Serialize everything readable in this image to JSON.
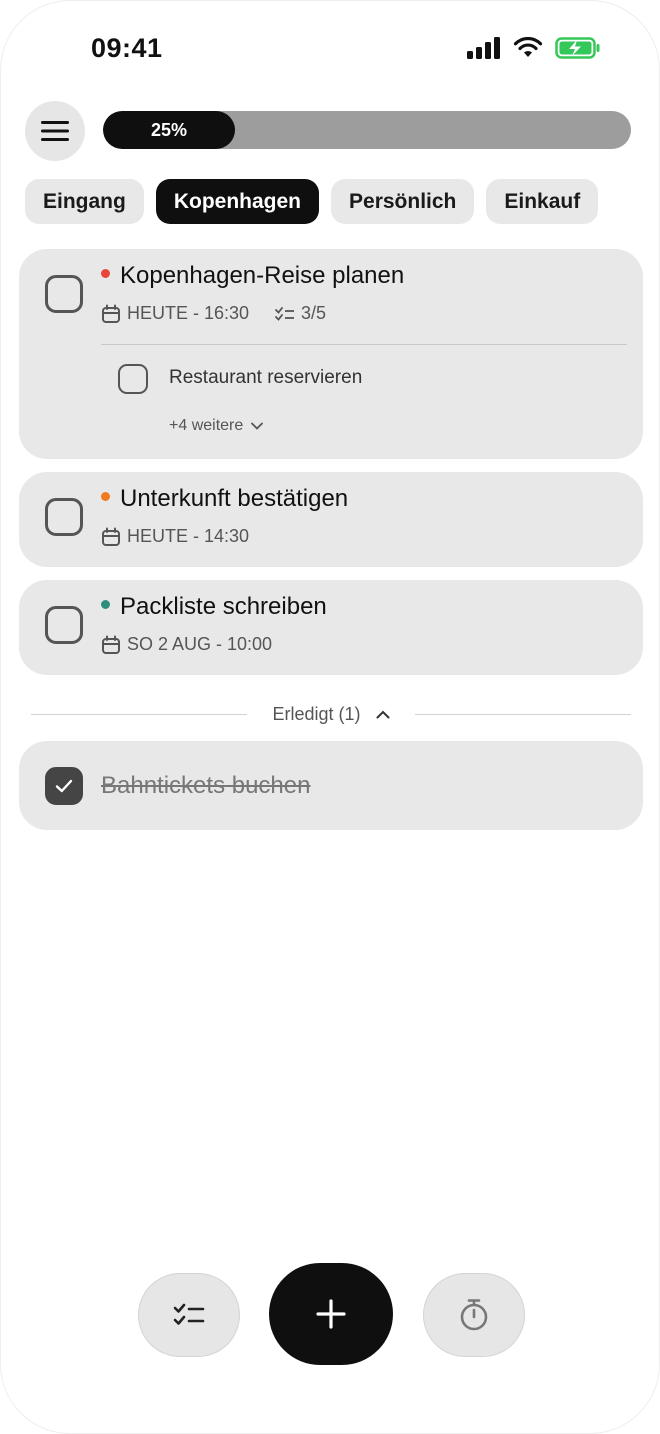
{
  "status": {
    "time": "09:41"
  },
  "progress": {
    "percent": 25,
    "label": "25%"
  },
  "tabs": [
    {
      "label": "Eingang",
      "active": false
    },
    {
      "label": "Kopenhagen",
      "active": true
    },
    {
      "label": "Persönlich",
      "active": false
    },
    {
      "label": "Einkauf",
      "active": false
    }
  ],
  "tasks": [
    {
      "title": "Kopenhagen-Reise planen",
      "priority_color": "#e8453c",
      "date": "HEUTE - 16:30",
      "subtasks_count": "3/5",
      "subtask": {
        "title": "Restaurant reservieren"
      },
      "more_label": "+4 weitere"
    },
    {
      "title": "Unterkunft bestätigen",
      "priority_color": "#f07a1e",
      "date": "HEUTE - 14:30"
    },
    {
      "title": "Packliste schreiben",
      "priority_color": "#2f8f7f",
      "date": "SO 2 AUG - 10:00"
    }
  ],
  "completed": {
    "label": "Erledigt (1)",
    "tasks": [
      {
        "title": "Bahntickets buchen"
      }
    ]
  },
  "colors": {
    "accent": "#0f0f0f",
    "card": "#e8e8e8",
    "progress_track": "#9d9d9d",
    "battery": "#34c759"
  },
  "icons": {
    "menu": "menu-icon",
    "calendar": "calendar-icon",
    "checklist": "checklist-icon",
    "add": "plus-icon",
    "timer": "stopwatch-icon"
  }
}
